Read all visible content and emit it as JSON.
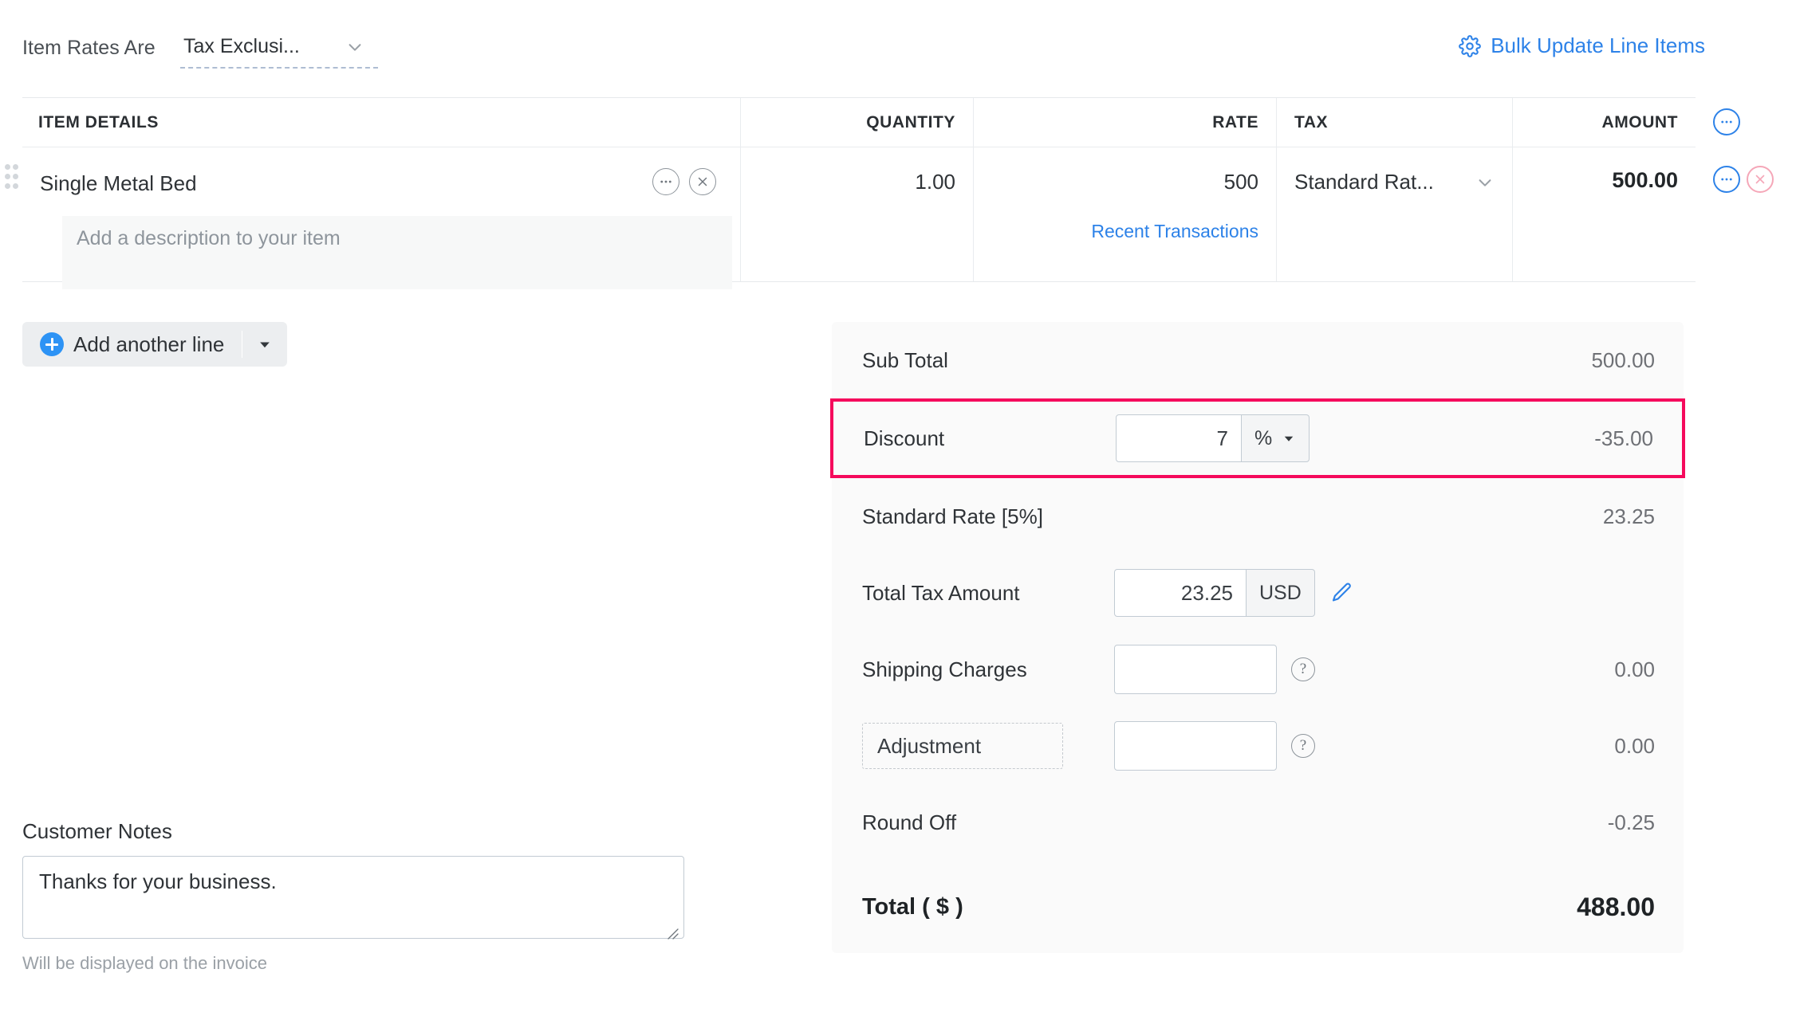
{
  "toolbar": {
    "rates_label": "Item Rates Are",
    "rates_value": "Tax Exclusi...",
    "bulk_update_label": "Bulk Update Line Items",
    "accent_blue": "#2d82e8"
  },
  "items_table": {
    "headers": {
      "item_details": "ITEM DETAILS",
      "quantity": "QUANTITY",
      "rate": "RATE",
      "tax": "TAX",
      "amount": "AMOUNT"
    },
    "rows": [
      {
        "name": "Single Metal Bed",
        "description_placeholder": "Add a description to your item",
        "quantity": "1.00",
        "rate": "500",
        "recent_transactions_label": "Recent Transactions",
        "tax": "Standard Rat...",
        "amount": "500.00"
      }
    ],
    "add_line_label": "Add another line"
  },
  "summary": {
    "sub_total_label": "Sub Total",
    "sub_total_value": "500.00",
    "discount_label": "Discount",
    "discount_input": "7",
    "discount_unit": "%",
    "discount_value": "-35.00",
    "tax_rate_label": "Standard Rate [5%]",
    "tax_rate_value": "23.25",
    "total_tax_label": "Total Tax Amount",
    "total_tax_input": "23.25",
    "total_tax_currency": "USD",
    "shipping_label": "Shipping Charges",
    "shipping_input": "",
    "shipping_value": "0.00",
    "adjustment_label": "Adjustment",
    "adjustment_input": "",
    "adjustment_value": "0.00",
    "round_off_label": "Round Off",
    "round_off_value": "-0.25",
    "total_label": "Total ( $ )",
    "total_value": "488.00",
    "highlight_color": "#f50a5c"
  },
  "notes": {
    "title": "Customer Notes",
    "value": "Thanks for your business.",
    "hint": "Will be displayed on the invoice"
  }
}
